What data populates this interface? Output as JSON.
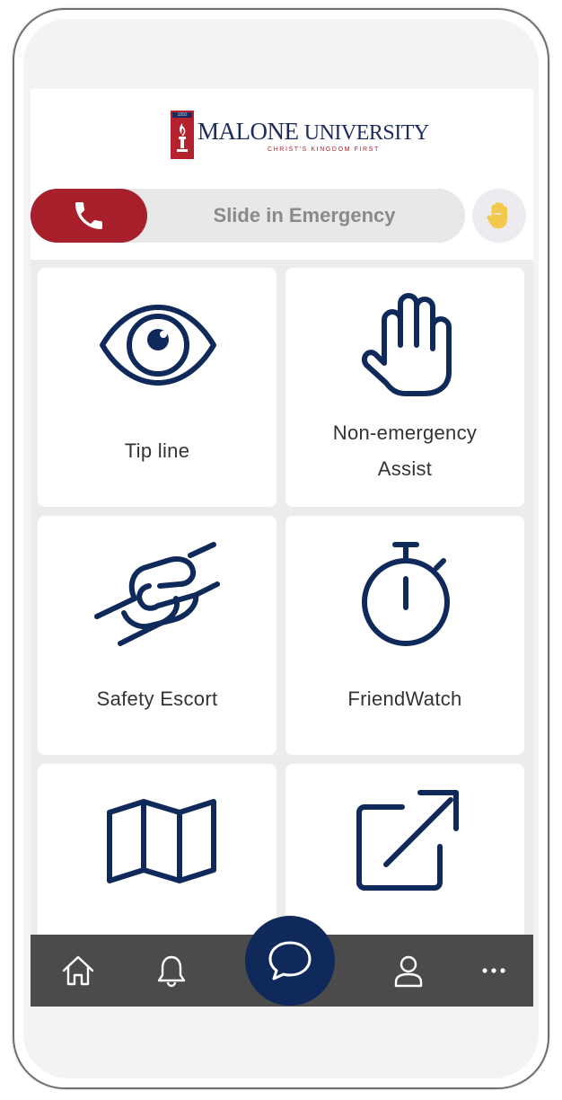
{
  "brand": {
    "name_part1": "MALONE",
    "name_part2": "UNIVERSITY",
    "tagline": "CHRIST'S KINGDOM FIRST",
    "year": "1892",
    "color_navy": "#1b2a5c",
    "color_red": "#b4222d"
  },
  "emergency": {
    "slider_label": "Slide in Emergency",
    "knob_icon": "phone-icon",
    "hand_icon": "raised-hand-icon",
    "accent": "#a61f2b"
  },
  "tiles": [
    {
      "label": "Tip line",
      "icon": "eye-icon"
    },
    {
      "label_line1": "Non-emergency",
      "label_line2": "Assist",
      "icon": "hand-icon"
    },
    {
      "label": "Safety Escort",
      "icon": "handshake-icon"
    },
    {
      "label": "FriendWatch",
      "icon": "stopwatch-icon"
    },
    {
      "label": "",
      "icon": "map-icon"
    },
    {
      "label": "",
      "icon": "external-link-icon"
    }
  ],
  "nav": {
    "items": [
      "home-icon",
      "bell-icon",
      "chat-icon",
      "user-icon",
      "more-icon"
    ],
    "bar_color": "#4b4b4b",
    "chat_color": "#0f2a5a"
  },
  "icon_color": "#0f2a5a"
}
